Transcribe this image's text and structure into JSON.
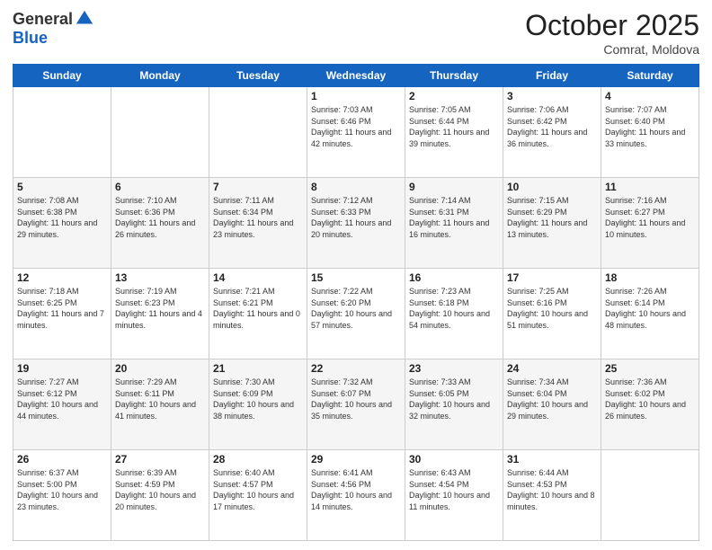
{
  "logo": {
    "general": "General",
    "blue": "Blue"
  },
  "header": {
    "month": "October 2025",
    "location": "Comrat, Moldova"
  },
  "days_of_week": [
    "Sunday",
    "Monday",
    "Tuesday",
    "Wednesday",
    "Thursday",
    "Friday",
    "Saturday"
  ],
  "weeks": [
    [
      {
        "day": "",
        "info": ""
      },
      {
        "day": "",
        "info": ""
      },
      {
        "day": "",
        "info": ""
      },
      {
        "day": "1",
        "info": "Sunrise: 7:03 AM\nSunset: 6:46 PM\nDaylight: 11 hours and 42 minutes."
      },
      {
        "day": "2",
        "info": "Sunrise: 7:05 AM\nSunset: 6:44 PM\nDaylight: 11 hours and 39 minutes."
      },
      {
        "day": "3",
        "info": "Sunrise: 7:06 AM\nSunset: 6:42 PM\nDaylight: 11 hours and 36 minutes."
      },
      {
        "day": "4",
        "info": "Sunrise: 7:07 AM\nSunset: 6:40 PM\nDaylight: 11 hours and 33 minutes."
      }
    ],
    [
      {
        "day": "5",
        "info": "Sunrise: 7:08 AM\nSunset: 6:38 PM\nDaylight: 11 hours and 29 minutes."
      },
      {
        "day": "6",
        "info": "Sunrise: 7:10 AM\nSunset: 6:36 PM\nDaylight: 11 hours and 26 minutes."
      },
      {
        "day": "7",
        "info": "Sunrise: 7:11 AM\nSunset: 6:34 PM\nDaylight: 11 hours and 23 minutes."
      },
      {
        "day": "8",
        "info": "Sunrise: 7:12 AM\nSunset: 6:33 PM\nDaylight: 11 hours and 20 minutes."
      },
      {
        "day": "9",
        "info": "Sunrise: 7:14 AM\nSunset: 6:31 PM\nDaylight: 11 hours and 16 minutes."
      },
      {
        "day": "10",
        "info": "Sunrise: 7:15 AM\nSunset: 6:29 PM\nDaylight: 11 hours and 13 minutes."
      },
      {
        "day": "11",
        "info": "Sunrise: 7:16 AM\nSunset: 6:27 PM\nDaylight: 11 hours and 10 minutes."
      }
    ],
    [
      {
        "day": "12",
        "info": "Sunrise: 7:18 AM\nSunset: 6:25 PM\nDaylight: 11 hours and 7 minutes."
      },
      {
        "day": "13",
        "info": "Sunrise: 7:19 AM\nSunset: 6:23 PM\nDaylight: 11 hours and 4 minutes."
      },
      {
        "day": "14",
        "info": "Sunrise: 7:21 AM\nSunset: 6:21 PM\nDaylight: 11 hours and 0 minutes."
      },
      {
        "day": "15",
        "info": "Sunrise: 7:22 AM\nSunset: 6:20 PM\nDaylight: 10 hours and 57 minutes."
      },
      {
        "day": "16",
        "info": "Sunrise: 7:23 AM\nSunset: 6:18 PM\nDaylight: 10 hours and 54 minutes."
      },
      {
        "day": "17",
        "info": "Sunrise: 7:25 AM\nSunset: 6:16 PM\nDaylight: 10 hours and 51 minutes."
      },
      {
        "day": "18",
        "info": "Sunrise: 7:26 AM\nSunset: 6:14 PM\nDaylight: 10 hours and 48 minutes."
      }
    ],
    [
      {
        "day": "19",
        "info": "Sunrise: 7:27 AM\nSunset: 6:12 PM\nDaylight: 10 hours and 44 minutes."
      },
      {
        "day": "20",
        "info": "Sunrise: 7:29 AM\nSunset: 6:11 PM\nDaylight: 10 hours and 41 minutes."
      },
      {
        "day": "21",
        "info": "Sunrise: 7:30 AM\nSunset: 6:09 PM\nDaylight: 10 hours and 38 minutes."
      },
      {
        "day": "22",
        "info": "Sunrise: 7:32 AM\nSunset: 6:07 PM\nDaylight: 10 hours and 35 minutes."
      },
      {
        "day": "23",
        "info": "Sunrise: 7:33 AM\nSunset: 6:05 PM\nDaylight: 10 hours and 32 minutes."
      },
      {
        "day": "24",
        "info": "Sunrise: 7:34 AM\nSunset: 6:04 PM\nDaylight: 10 hours and 29 minutes."
      },
      {
        "day": "25",
        "info": "Sunrise: 7:36 AM\nSunset: 6:02 PM\nDaylight: 10 hours and 26 minutes."
      }
    ],
    [
      {
        "day": "26",
        "info": "Sunrise: 6:37 AM\nSunset: 5:00 PM\nDaylight: 10 hours and 23 minutes."
      },
      {
        "day": "27",
        "info": "Sunrise: 6:39 AM\nSunset: 4:59 PM\nDaylight: 10 hours and 20 minutes."
      },
      {
        "day": "28",
        "info": "Sunrise: 6:40 AM\nSunset: 4:57 PM\nDaylight: 10 hours and 17 minutes."
      },
      {
        "day": "29",
        "info": "Sunrise: 6:41 AM\nSunset: 4:56 PM\nDaylight: 10 hours and 14 minutes."
      },
      {
        "day": "30",
        "info": "Sunrise: 6:43 AM\nSunset: 4:54 PM\nDaylight: 10 hours and 11 minutes."
      },
      {
        "day": "31",
        "info": "Sunrise: 6:44 AM\nSunset: 4:53 PM\nDaylight: 10 hours and 8 minutes."
      },
      {
        "day": "",
        "info": ""
      }
    ]
  ]
}
